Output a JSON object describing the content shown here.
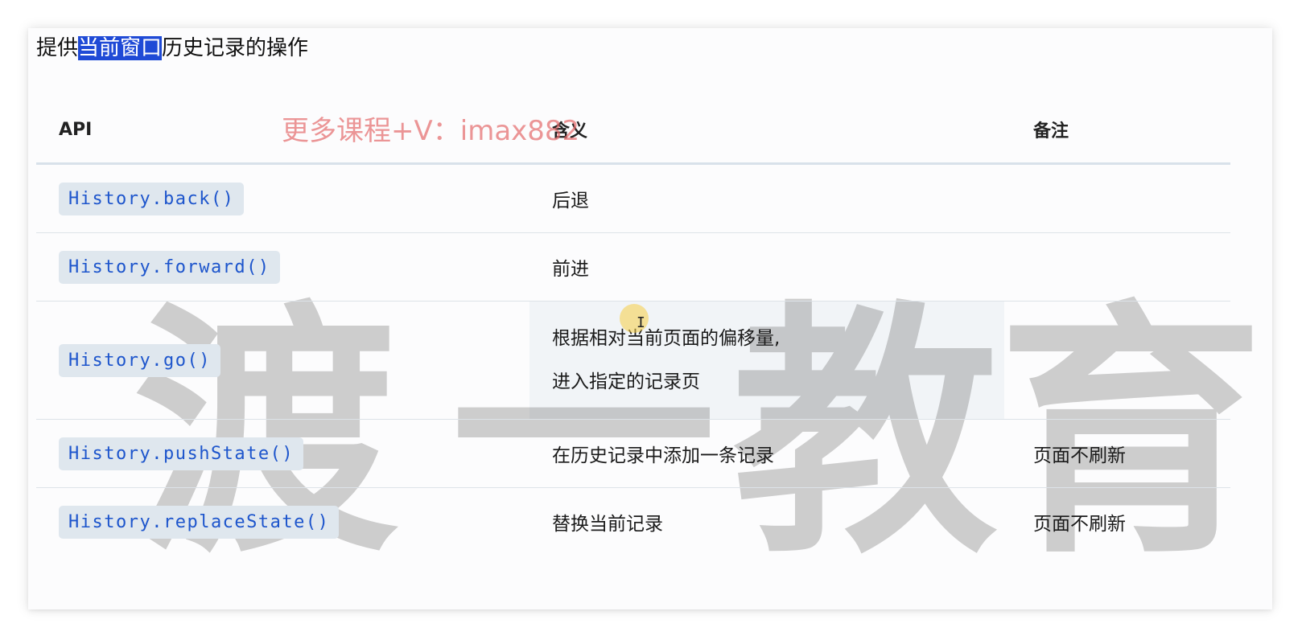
{
  "intro": {
    "before": "提供",
    "highlight": "当前窗口",
    "after": "历史记录的操作"
  },
  "promo_watermark": "更多课程+V：imax882",
  "brand_watermark": [
    "渡",
    "一",
    "教",
    "育"
  ],
  "table": {
    "headers": {
      "api": "API",
      "meaning": "含义",
      "note": "备注"
    },
    "rows": [
      {
        "api": "History.back()",
        "meaning": "后退",
        "note": ""
      },
      {
        "api": "History.forward()",
        "meaning": "前进",
        "note": ""
      },
      {
        "api": "History.go()",
        "meaning_line1": "根据相对当前页面的偏移量,",
        "meaning_line2": "进入指定的记录页",
        "note": ""
      },
      {
        "api": "History.pushState()",
        "meaning": "在历史记录中添加一条记录",
        "note": "页面不刷新"
      },
      {
        "api": "History.replaceState()",
        "meaning": "替换当前记录",
        "note": "页面不刷新"
      }
    ]
  },
  "colors": {
    "code_text": "#1d55cc",
    "code_bg": "#dfe7ee",
    "selection": "#1f4ad6"
  }
}
